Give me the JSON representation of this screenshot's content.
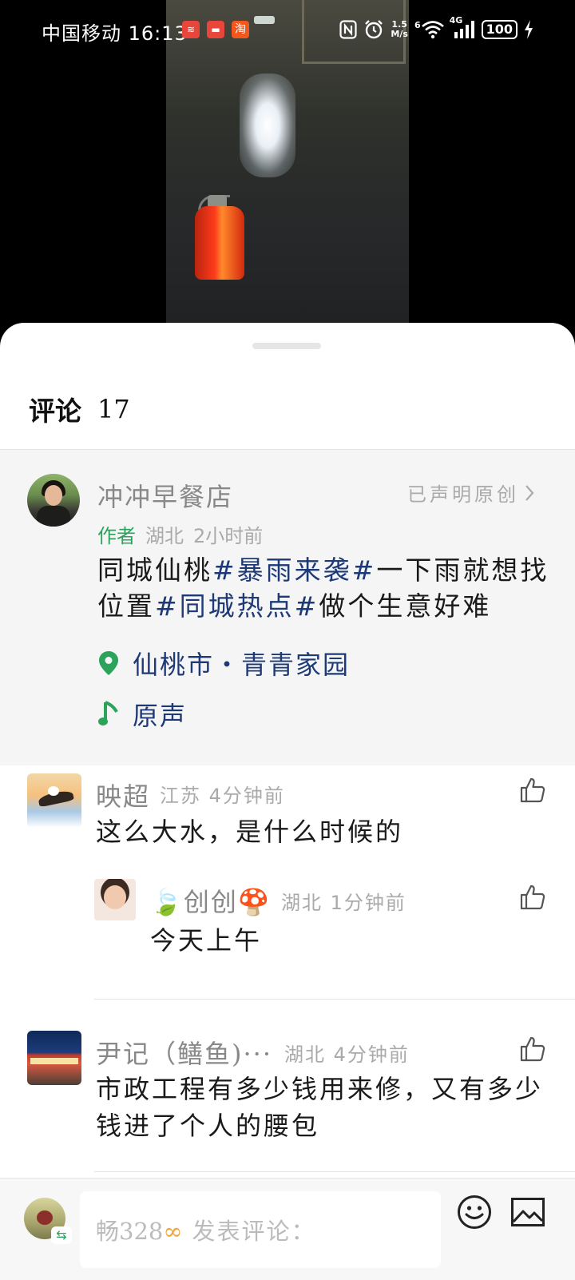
{
  "status_bar": {
    "carrier": "中国移动",
    "time": "16:13",
    "app_icons": [
      {
        "name": "app-notify-icon-1",
        "glyph": "≋",
        "color": "#e8463a"
      },
      {
        "name": "app-notify-icon-2",
        "glyph": "▬",
        "color": "#e8463a"
      },
      {
        "name": "taobao-icon",
        "glyph": "淘",
        "color": "#f2581e"
      }
    ],
    "network_speed_value": "1.5",
    "network_speed_unit": "M/s",
    "wifi_gen": "6",
    "signal_type": "4G",
    "battery": "100"
  },
  "sheet": {
    "title": "评论",
    "count": "17"
  },
  "post": {
    "author": "冲冲早餐店",
    "declared_original": "已声明原创",
    "author_tag": "作者",
    "region": "湖北",
    "time": "2小时前",
    "caption_parts": [
      {
        "text": "同城仙桃",
        "tag": false
      },
      {
        "text": "#暴雨来袭#",
        "tag": true
      },
      {
        "text": "一下雨就想找位置",
        "tag": false
      },
      {
        "text": "#同城热点#",
        "tag": true
      },
      {
        "text": "做个生意好难",
        "tag": false
      }
    ],
    "location": "仙桃市・青青家园",
    "music": "原声"
  },
  "comments": [
    {
      "name": "映超",
      "region": "江苏",
      "time": "4分钟前",
      "text": "这么大水，是什么时候的"
    },
    {
      "name": "🍃创创🍄",
      "region": "湖北",
      "time": "1分钟前",
      "text": "今天上午"
    },
    {
      "name": "尹记（鳝鱼)···",
      "region": "湖北",
      "time": "4分钟前",
      "text": "市政工程有多少钱用来修，又有多少钱进了个人的腰包"
    }
  ],
  "input_bar": {
    "prefix": "畅328",
    "placeholder": "发表评论：",
    "accent_color": "#f0a53a"
  },
  "colors": {
    "author_green": "#2ba35a",
    "link_blue": "#1d3a77",
    "grey_text": "#aaaaaa"
  }
}
